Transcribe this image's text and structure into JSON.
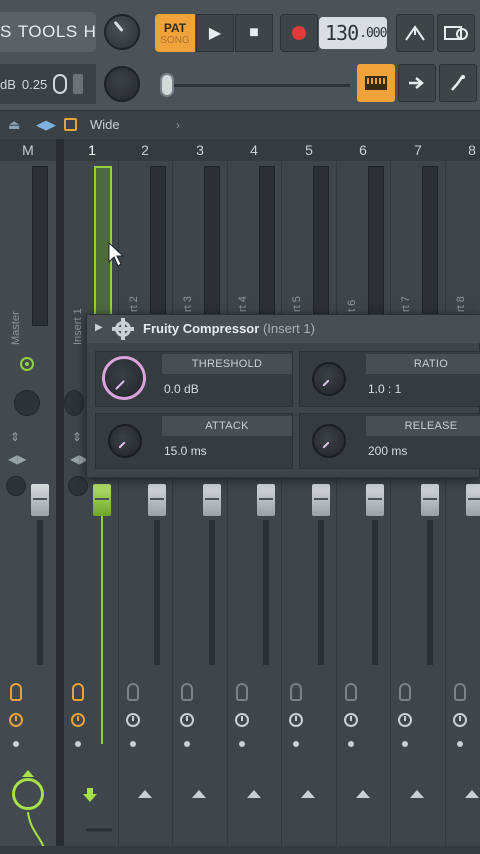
{
  "menu": {
    "items": [
      "S",
      "TOOLS",
      "HELP"
    ]
  },
  "transport": {
    "pat_label": "PAT",
    "song_label": "SONG",
    "play_icon": "▶",
    "stop_icon": "■",
    "tempo_main": "130",
    "tempo_frac": ".000"
  },
  "status": {
    "db_text": "dB",
    "value_text": "0.25"
  },
  "header": {
    "stereo_label": "Wide",
    "chev": "›"
  },
  "mixer": {
    "columns": [
      "M",
      "1",
      "2",
      "3",
      "4",
      "5",
      "6",
      "7",
      "8"
    ],
    "strip_labels": [
      "Master",
      "Insert 1",
      "rt 2",
      "rt 3",
      "rt 4",
      "rt 5",
      "t 6",
      "rt 7",
      "rt 8"
    ]
  },
  "plugin": {
    "title": "Fruity Compressor",
    "insert": "(Insert 1)",
    "params": [
      {
        "label": "THRESHOLD",
        "value": "0.0 dB"
      },
      {
        "label": "RATIO",
        "value": "1.0 : 1"
      },
      {
        "label": "ATTACK",
        "value": "15.0 ms"
      },
      {
        "label": "RELEASE",
        "value": "200 ms"
      }
    ]
  },
  "colors": {
    "accent": "#f0a33b",
    "selected_green": "#8fd13f",
    "record_red": "#e03a3a",
    "knob_pink": "#d9a3de"
  }
}
